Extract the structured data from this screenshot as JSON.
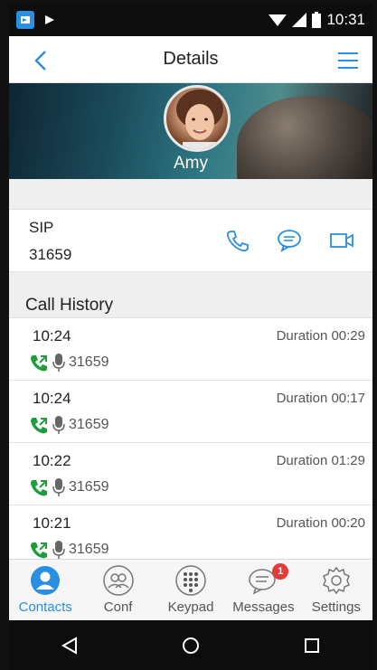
{
  "status_bar": {
    "time": "10:31"
  },
  "header": {
    "title": "Details"
  },
  "contact": {
    "name": "Amy",
    "type_label": "SIP",
    "number": "31659"
  },
  "history": {
    "title": "Call History",
    "items": [
      {
        "time": "10:24",
        "duration": "Duration 00:29",
        "number": "31659"
      },
      {
        "time": "10:24",
        "duration": "Duration 00:17",
        "number": "31659"
      },
      {
        "time": "10:22",
        "duration": "Duration 01:29",
        "number": "31659"
      },
      {
        "time": "10:21",
        "duration": "Duration 00:20",
        "number": "31659"
      }
    ]
  },
  "tabs": [
    {
      "label": "Contacts",
      "icon": "contacts-icon",
      "active": true
    },
    {
      "label": "Conf",
      "icon": "conference-icon"
    },
    {
      "label": "Keypad",
      "icon": "keypad-icon"
    },
    {
      "label": "Messages",
      "icon": "messages-icon",
      "badge": "1"
    },
    {
      "label": "Settings",
      "icon": "settings-icon"
    }
  ],
  "colors": {
    "accent": "#2a8fe0",
    "call_green": "#1e9e3a",
    "badge_red": "#e53935"
  }
}
